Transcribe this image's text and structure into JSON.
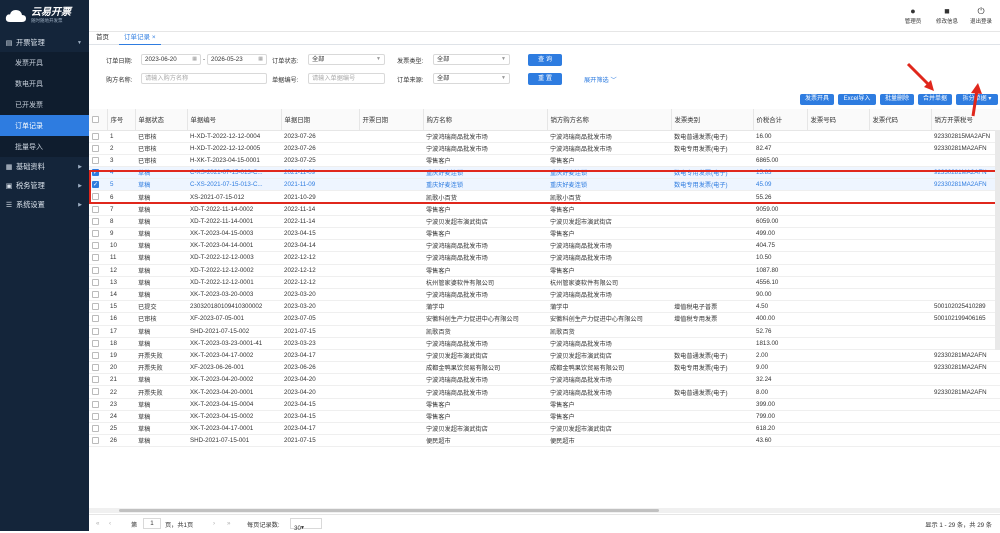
{
  "app": {
    "logo_title": "云易开票",
    "logo_subtitle": "随时随地开发票"
  },
  "header": {
    "actions": [
      {
        "label": "管理员",
        "icon": "user-icon"
      },
      {
        "label": "修改信息",
        "icon": "lock-icon"
      },
      {
        "label": "退出登录",
        "icon": "power-icon"
      }
    ]
  },
  "sidebar": {
    "groups": [
      {
        "label": "开票管理",
        "icon": "invoice-icon",
        "expanded": true,
        "items": [
          {
            "label": "发票开具"
          },
          {
            "label": "数电开具"
          },
          {
            "label": "已开发票"
          },
          {
            "label": "订单记录",
            "active": true
          },
          {
            "label": "批量导入"
          }
        ]
      },
      {
        "label": "基础资料",
        "icon": "grid-icon"
      },
      {
        "label": "税务管理",
        "icon": "briefcase-icon"
      },
      {
        "label": "系统设置",
        "icon": "settings-icon"
      }
    ]
  },
  "tabs": [
    {
      "label": "首页"
    },
    {
      "label": "订单记录",
      "active": true,
      "close": "×"
    }
  ],
  "filters": {
    "order_date_label": "订单日期:",
    "date_from": "2023-06-20",
    "date_sep": "-",
    "date_to": "2026-05-23",
    "order_status_label": "订单状态:",
    "order_status_value": "全部",
    "invoice_type_label": "发票类型:",
    "invoice_type_value": "全部",
    "query_button": "查 询",
    "buyer_label": "购方名称:",
    "buyer_placeholder": "请输入购方名称",
    "doc_no_label": "单据编号:",
    "doc_no_placeholder": "请输入单据编号",
    "order_source_label": "订单来源:",
    "order_source_value": "全部",
    "reset_button": "重 置",
    "expand_link": "展开筛选"
  },
  "toolbar": {
    "buttons": [
      "发票开具",
      "Excel导入",
      "批量删除",
      "合并单据",
      "拆分单据"
    ]
  },
  "table": {
    "columns": [
      "序号",
      "单据状态",
      "单据编号",
      "单据日期",
      "开票日期",
      "购方名称",
      "销方购方名称",
      "发票类别",
      "价税合计",
      "发票号码",
      "发票代码",
      "销方开票税号"
    ],
    "rows": [
      {
        "no": "1",
        "status": "已审核",
        "doc": "H-XD-T-2022-12-12-0004",
        "date": "2023-07-26",
        "idate": "",
        "buyer": "宁波鸿瑞商品批发市场",
        "name": "宁波鸿瑞商品批发市场",
        "type": "数电普通发票(电子)",
        "amount": "16.00",
        "inv_no": "",
        "inv_code": "",
        "tax": "923302815MA2AFN"
      },
      {
        "no": "2",
        "status": "已审核",
        "doc": "H-XD-T-2022-12-12-0005",
        "date": "2023-07-26",
        "idate": "",
        "buyer": "宁波鸿瑞商品批发市场",
        "name": "宁波鸿瑞商品批发市场",
        "type": "数电专用发票(电子)",
        "amount": "82.47",
        "inv_no": "",
        "inv_code": "",
        "tax": "92330281MA2AFN"
      },
      {
        "no": "3",
        "status": "已审核",
        "doc": "H-XK-T-2023-04-15-0001",
        "date": "2023-07-25",
        "idate": "",
        "buyer": "零售客户",
        "name": "零售客户",
        "type": "",
        "amount": "6865.00",
        "inv_no": "",
        "inv_code": "",
        "tax": ""
      },
      {
        "no": "4",
        "status": "草稿",
        "doc": "C-XS-2021-07-15-013-C...",
        "date": "2021-11-09",
        "idate": "",
        "buyer": "重庆好麦连锁",
        "name": "重庆好麦连锁",
        "type": "数电专用发票(电子)",
        "amount": "15.83",
        "inv_no": "",
        "inv_code": "",
        "tax": "92330281MA2AFN",
        "sel": true
      },
      {
        "no": "5",
        "status": "草稿",
        "doc": "C-XS-2021-07-15-013-C...",
        "date": "2021-11-09",
        "idate": "",
        "buyer": "重庆好麦连锁",
        "name": "重庆好麦连锁",
        "type": "数电专用发票(电子)",
        "amount": "45.09",
        "inv_no": "",
        "inv_code": "",
        "tax": "92330281MA2AFN",
        "sel": true
      },
      {
        "no": "6",
        "status": "草稿",
        "doc": "XS-2021-07-15-012",
        "date": "2021-10-29",
        "idate": "",
        "buyer": "凯歌小百货",
        "name": "凯歌小百货",
        "type": "",
        "amount": "55.26",
        "inv_no": "",
        "inv_code": "",
        "tax": ""
      },
      {
        "no": "7",
        "status": "草稿",
        "doc": "XD-T-2022-11-14-0002",
        "date": "2022-11-14",
        "idate": "",
        "buyer": "零售客户",
        "name": "零售客户",
        "type": "",
        "amount": "9059.00",
        "inv_no": "",
        "inv_code": "",
        "tax": ""
      },
      {
        "no": "8",
        "status": "草稿",
        "doc": "XD-T-2022-11-14-0001",
        "date": "2022-11-14",
        "idate": "",
        "buyer": "宁波贝发超市演武街店",
        "name": "宁波贝发超市演武街店",
        "type": "",
        "amount": "6059.00",
        "inv_no": "",
        "inv_code": "",
        "tax": ""
      },
      {
        "no": "9",
        "status": "草稿",
        "doc": "XK-T-2023-04-15-0003",
        "date": "2023-04-15",
        "idate": "",
        "buyer": "零售客户",
        "name": "零售客户",
        "type": "",
        "amount": "499.00",
        "inv_no": "",
        "inv_code": "",
        "tax": ""
      },
      {
        "no": "10",
        "status": "草稿",
        "doc": "XK-T-2023-04-14-0001",
        "date": "2023-04-14",
        "idate": "",
        "buyer": "宁波鸿瑞商品批发市场",
        "name": "宁波鸿瑞商品批发市场",
        "type": "",
        "amount": "404.75",
        "inv_no": "",
        "inv_code": "",
        "tax": ""
      },
      {
        "no": "11",
        "status": "草稿",
        "doc": "XD-T-2022-12-12-0003",
        "date": "2022-12-12",
        "idate": "",
        "buyer": "宁波鸿瑞商品批发市场",
        "name": "宁波鸿瑞商品批发市场",
        "type": "",
        "amount": "10.50",
        "inv_no": "",
        "inv_code": "",
        "tax": ""
      },
      {
        "no": "12",
        "status": "草稿",
        "doc": "XD-T-2022-12-12-0002",
        "date": "2022-12-12",
        "idate": "",
        "buyer": "零售客户",
        "name": "零售客户",
        "type": "",
        "amount": "1087.80",
        "inv_no": "",
        "inv_code": "",
        "tax": ""
      },
      {
        "no": "13",
        "status": "草稿",
        "doc": "XD-T-2022-12-12-0001",
        "date": "2022-12-12",
        "idate": "",
        "buyer": "杭州管家婆软件有限公司",
        "name": "杭州管家婆软件有限公司",
        "type": "",
        "amount": "4556.10",
        "inv_no": "",
        "inv_code": "",
        "tax": ""
      },
      {
        "no": "14",
        "status": "草稿",
        "doc": "XK-T-2023-03-20-0003",
        "date": "2023-03-20",
        "idate": "",
        "buyer": "宁波鸿瑞商品批发市场",
        "name": "宁波鸿瑞商品批发市场",
        "type": "",
        "amount": "90.00",
        "inv_no": "",
        "inv_code": "",
        "tax": ""
      },
      {
        "no": "15",
        "status": "已提交",
        "doc": "230320180109410300002",
        "date": "2023-03-20",
        "idate": "",
        "buyer": "蒲学中",
        "name": "蒲学中",
        "type": "增值税电子普票",
        "amount": "4.50",
        "inv_no": "",
        "inv_code": "",
        "tax": "500102025410289"
      },
      {
        "no": "16",
        "status": "已审核",
        "doc": "XF-2023-07-05-001",
        "date": "2023-07-05",
        "idate": "",
        "buyer": "安徽科创生产力促进中心有限公司",
        "name": "安徽科创生产力促进中心有限公司",
        "type": "增值税专用发票",
        "amount": "400.00",
        "inv_no": "",
        "inv_code": "",
        "tax": "500102199406165"
      },
      {
        "no": "17",
        "status": "草稿",
        "doc": "SHD-2021-07-15-002",
        "date": "2021-07-15",
        "idate": "",
        "buyer": "凯歌百货",
        "name": "凯歌百货",
        "type": "",
        "amount": "52.76",
        "inv_no": "",
        "inv_code": "",
        "tax": ""
      },
      {
        "no": "18",
        "status": "草稿",
        "doc": "XK-T-2023-03-23-0001-41",
        "date": "2023-03-23",
        "idate": "",
        "buyer": "宁波鸿瑞商品批发市场",
        "name": "宁波鸿瑞商品批发市场",
        "type": "",
        "amount": "1813.00",
        "inv_no": "",
        "inv_code": "",
        "tax": ""
      },
      {
        "no": "19",
        "status": "开票失败",
        "doc": "XK-T-2023-04-17-0002",
        "date": "2023-04-17",
        "idate": "",
        "buyer": "宁波贝发超市演武街店",
        "name": "宁波贝发超市演武街店",
        "type": "数电普通发票(电子)",
        "amount": "2.00",
        "inv_no": "",
        "inv_code": "",
        "tax": "92330281MA2AFN"
      },
      {
        "no": "20",
        "status": "开票失败",
        "doc": "XF-2023-06-26-001",
        "date": "2023-06-26",
        "idate": "",
        "buyer": "成都金鸭果饮贸易有限公司",
        "name": "成都金鸭果饮贸易有限公司",
        "type": "数电专用发票(电子)",
        "amount": "9.00",
        "inv_no": "",
        "inv_code": "",
        "tax": "92330281MA2AFN"
      },
      {
        "no": "21",
        "status": "草稿",
        "doc": "XK-T-2023-04-20-0002",
        "date": "2023-04-20",
        "idate": "",
        "buyer": "宁波鸿瑞商品批发市场",
        "name": "宁波鸿瑞商品批发市场",
        "type": "",
        "amount": "32.24",
        "inv_no": "",
        "inv_code": "",
        "tax": ""
      },
      {
        "no": "22",
        "status": "开票失败",
        "doc": "XK-T-2023-04-20-0001",
        "date": "2023-04-20",
        "idate": "",
        "buyer": "宁波鸿瑞商品批发市场",
        "name": "宁波鸿瑞商品批发市场",
        "type": "数电普通发票(电子)",
        "amount": "8.00",
        "inv_no": "",
        "inv_code": "",
        "tax": "92330281MA2AFN"
      },
      {
        "no": "23",
        "status": "草稿",
        "doc": "XK-T-2023-04-15-0004",
        "date": "2023-04-15",
        "idate": "",
        "buyer": "零售客户",
        "name": "零售客户",
        "type": "",
        "amount": "399.00",
        "inv_no": "",
        "inv_code": "",
        "tax": ""
      },
      {
        "no": "24",
        "status": "草稿",
        "doc": "XK-T-2023-04-15-0002",
        "date": "2023-04-15",
        "idate": "",
        "buyer": "零售客户",
        "name": "零售客户",
        "type": "",
        "amount": "799.00",
        "inv_no": "",
        "inv_code": "",
        "tax": ""
      },
      {
        "no": "25",
        "status": "草稿",
        "doc": "XK-T-2023-04-17-0001",
        "date": "2023-04-17",
        "idate": "",
        "buyer": "宁波贝发超市演武街店",
        "name": "宁波贝发超市演武街店",
        "type": "",
        "amount": "618.20",
        "inv_no": "",
        "inv_code": "",
        "tax": ""
      },
      {
        "no": "26",
        "status": "草稿",
        "doc": "SHD-2021-07-15-001",
        "date": "2021-07-15",
        "idate": "",
        "buyer": "便民超市",
        "name": "便民超市",
        "type": "",
        "amount": "43.60",
        "inv_no": "",
        "inv_code": "",
        "tax": ""
      }
    ]
  },
  "pager": {
    "page_label": "第",
    "page_value": "1",
    "page_of": "页，共1页",
    "size_label": "每页记录数:",
    "size_value": "30",
    "summary": "显示 1 - 29 条，共 29 条"
  },
  "colors": {
    "sidebar": "#14253a",
    "accent": "#2e7ce0",
    "highlight": "#e0271c"
  }
}
